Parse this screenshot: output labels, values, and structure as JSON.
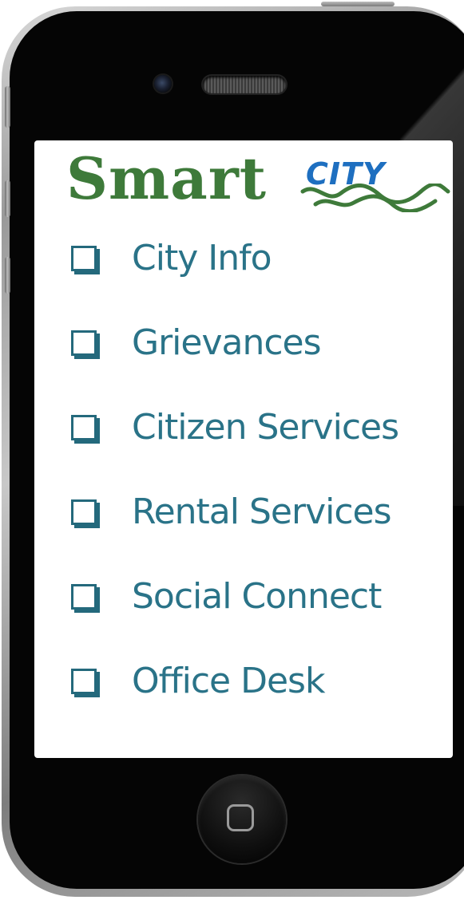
{
  "logo": {
    "smart": "Smart",
    "city": "CITY",
    "smart_color": "#3e7a3a",
    "city_color": "#1e6fc0"
  },
  "menu": {
    "items": [
      {
        "label": "City Info",
        "checked": false
      },
      {
        "label": "Grievances",
        "checked": false
      },
      {
        "label": "Citizen Services",
        "checked": false
      },
      {
        "label": "Rental Services",
        "checked": false
      },
      {
        "label": "Social Connect",
        "checked": false
      },
      {
        "label": "Office Desk",
        "checked": false
      }
    ],
    "accent_color": "#2a7388"
  },
  "device": {
    "home_icon": "home-button-icon",
    "camera_icon": "front-camera-icon",
    "speaker_icon": "earpiece-speaker-icon"
  }
}
